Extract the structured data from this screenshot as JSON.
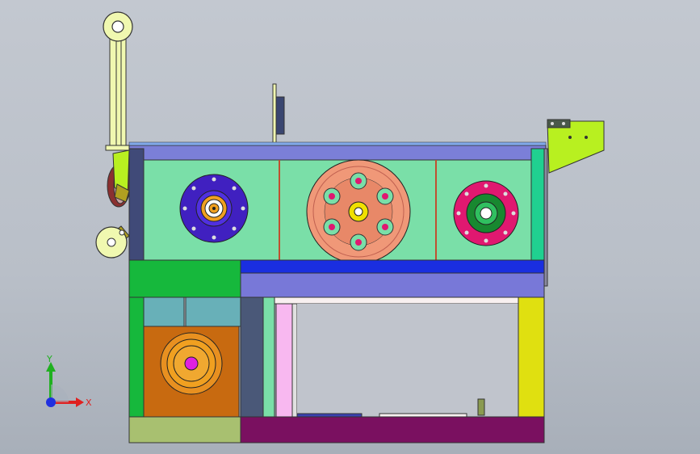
{
  "viewport": {
    "background_top": "#c3c8d0",
    "background_bottom": "#a8afb9"
  },
  "triad": {
    "x_label": "X",
    "y_label": "Y",
    "x_color": "#e02020",
    "y_color": "#20b020",
    "origin_color": "#2030e0"
  },
  "colors": {
    "frame_top": "#7b7fd8",
    "panel_green": "#7adfa8",
    "blue_bar": "#1a2ee0",
    "lavender_bar": "#7878d8",
    "green_block": "#16b83c",
    "orange_box": "#c86a10",
    "olive_bottom": "#a8c070",
    "purple_base": "#7a1060",
    "yellow_column": "#e0e010",
    "pink_column": "#f8b8f0",
    "teal_cell": "#68b0b8",
    "slate_column": "#4a5878",
    "lime_bracket": "#b8f020",
    "light_yellow_arm": "#f0f8b0",
    "left_gear_blue": "#4020c0",
    "center_wheel_salmon": "#f09878",
    "right_gear_magenta": "#e01870",
    "right_gear_green": "#188830",
    "yellow_hub": "#f0e000",
    "orange_ring": "#f0a020",
    "magenta_hub": "#e020e0"
  }
}
